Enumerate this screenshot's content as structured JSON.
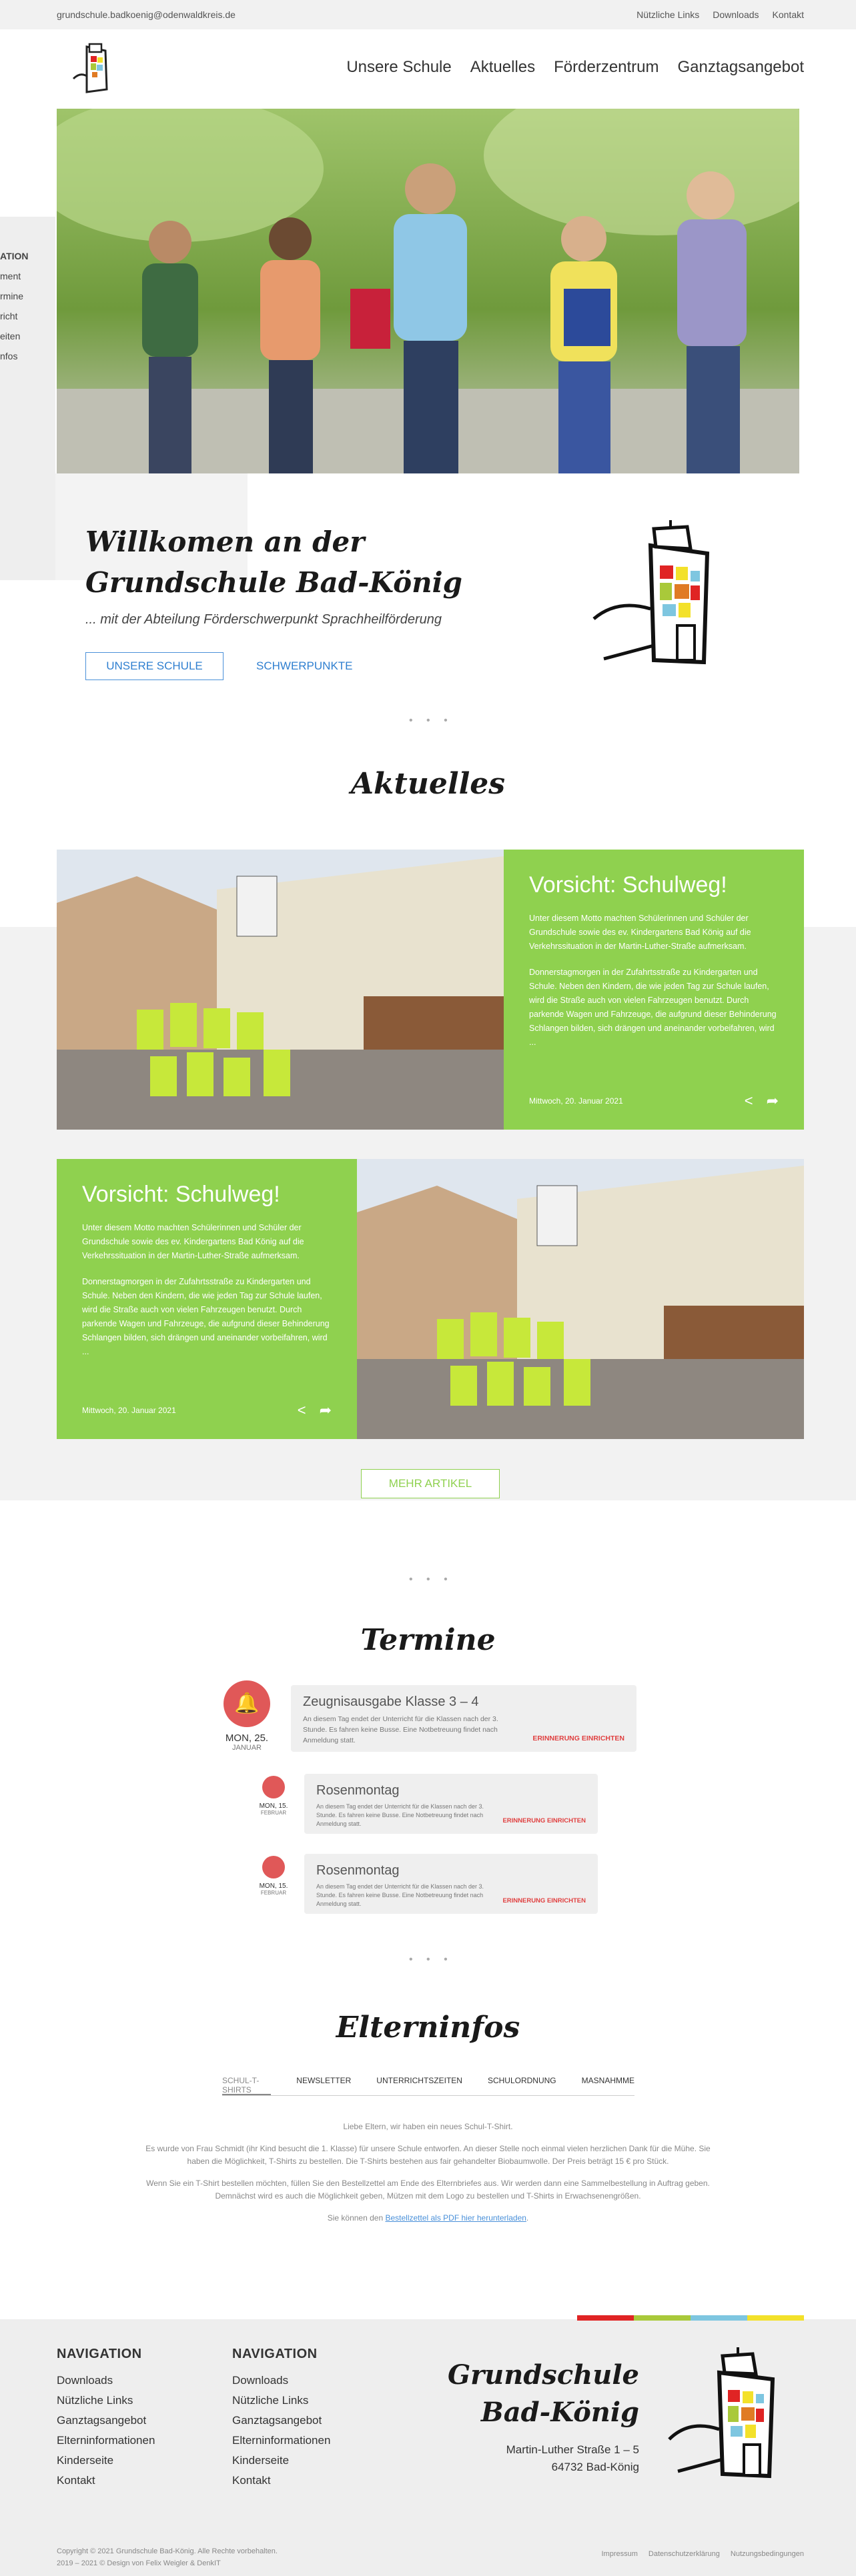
{
  "topbar": {
    "email": "grundschule.badkoenig@odenwaldkreis.de",
    "links": [
      "Nützliche Links",
      "Downloads",
      "Kontakt"
    ]
  },
  "nav": [
    "Unsere Schule",
    "Aktuelles",
    "Förderzentrum",
    "Ganztagsangebot"
  ],
  "side_menu": [
    "ATION",
    "ment",
    "rmine",
    "richt",
    "eiten",
    "nfos"
  ],
  "welcome": {
    "title_line1": "Willkomen an der",
    "title_line2": "Grundschule Bad-König",
    "subtitle": "... mit der Abteilung Förderschwerpunkt Sprachheilförderung",
    "btn_primary": "UNSERE SCHULE",
    "btn_secondary": "SCHWERPUNKTE"
  },
  "dots": "• • •",
  "aktuelles": {
    "title": "Aktuelles",
    "articles": [
      {
        "title": "Vorsicht: Schulweg!",
        "p1": "Unter diesem Motto machten Schülerinnen und Schüler der Grundschule sowie des ev. Kindergartens Bad König auf die Verkehrssituation in der Martin-Luther-Straße aufmerksam.",
        "p2": "Donnerstagmorgen in der Zufahrtsstraße zu Kindergarten und Schule. Neben den Kindern, die wie jeden Tag zur Schule laufen, wird die Straße auch von vielen Fahrzeugen benutzt. Durch parkende Wagen und Fahrzeuge, die aufgrund dieser Behinderung Schlangen bilden, sich drängen und aneinander vorbeifahren, wird ...",
        "date": "Mittwoch, 20. Januar 2021"
      },
      {
        "title": "Vorsicht: Schulweg!",
        "p1": "Unter diesem Motto machten Schülerinnen und Schüler der Grundschule sowie des ev. Kindergartens Bad König auf die Verkehrssituation in der Martin-Luther-Straße aufmerksam.",
        "p2": "Donnerstagmorgen in der Zufahrtsstraße zu Kindergarten und Schule. Neben den Kindern, die wie jeden Tag zur Schule laufen, wird die Straße auch von vielen Fahrzeugen benutzt. Durch parkende Wagen und Fahrzeuge, die aufgrund dieser Behinderung Schlangen bilden, sich drängen und aneinander vorbeifahren, wird ...",
        "date": "Mittwoch, 20. Januar 2021"
      }
    ],
    "more": "MEHR ARTIKEL"
  },
  "termine": {
    "title": "Termine",
    "events": [
      {
        "day": "MON, 25.",
        "month": "JANUAR",
        "title": "Zeugnisausgabe Klasse 3 – 4",
        "text": "An diesem Tag endet der Unterricht für die Klassen nach der 3. Stunde. Es fahren keine Busse. Eine Notbetreuung findet nach Anmeldung statt.",
        "remind": "ERINNERUNG EINRICHTEN"
      },
      {
        "day": "MON, 15.",
        "month": "FEBRUAR",
        "title": "Rosenmontag",
        "text": "An diesem Tag endet der Unterricht für die Klassen nach der 3. Stunde. Es fahren keine Busse. Eine Notbetreuung findet nach Anmeldung statt.",
        "remind": "ERINNERUNG EINRICHTEN"
      },
      {
        "day": "MON, 15.",
        "month": "FEBRUAR",
        "title": "Rosenmontag",
        "text": "An diesem Tag endet der Unterricht für die Klassen nach der 3. Stunde. Es fahren keine Busse. Eine Notbetreuung findet nach Anmeldung statt.",
        "remind": "ERINNERUNG EINRICHTEN"
      }
    ]
  },
  "elterninfos": {
    "title": "Elterninfos",
    "tabs": [
      "SCHUL-T-SHIRTS",
      "NEWSLETTER",
      "UNTERRICHTSZEITEN",
      "SCHULORDNUNG",
      "MASNAHMME"
    ],
    "p1": "Liebe Eltern, wir haben ein neues Schul-T-Shirt.",
    "p2": "Es wurde von Frau Schmidt (ihr Kind besucht die 1. Klasse) für unsere Schule entworfen. An dieser Stelle noch einmal vielen herzlichen Dank für die Mühe. Sie haben die Möglichkeit, T-Shirts zu bestellen. Die T-Shirts bestehen aus fair gehandelter Biobaumwolle. Der Preis beträgt 15 € pro Stück.",
    "p3": "Wenn Sie ein T-Shirt bestellen möchten, füllen Sie den Bestellzettel am Ende des Elternbriefes aus. Wir werden dann eine Sammelbestellung in Auftrag geben. Demnächst wird es auch die Möglichkeit geben, Mützen mit dem Logo zu bestellen und T-Shirts in Erwachsenengrößen.",
    "p4_prefix": "Sie können den ",
    "p4_link": "Bestellzettel als PDF hier herunterladen",
    "p4_suffix": "."
  },
  "footer": {
    "col1_title": "NAVIGATION",
    "col1": [
      "Downloads",
      "Nützliche Links",
      "Ganztagsangebot",
      "Elterninformationen",
      "Kinderseite",
      "Kontakt"
    ],
    "col2_title": "NAVIGATION",
    "col2": [
      "Downloads",
      "Nützliche Links",
      "Ganztagsangebot",
      "Elterninformationen",
      "Kinderseite",
      "Kontakt"
    ],
    "school_line1": "Grundschule",
    "school_line2": "Bad-König",
    "street": "Martin-Luther Straße 1 – 5",
    "city": "64732 Bad-König",
    "copy1": "Copyright © 2021 Grundschule Bad-König. Alle Rechte vorbehalten.",
    "copy2": "2019 – 2021 © Design von Felix Weigler & DenkIT",
    "legal": [
      "Impressum",
      "Datenschutzerklärung",
      "Nutzungsbedingungen"
    ],
    "bar_colors": [
      "#e02424",
      "#a9c93a",
      "#7ec6e0",
      "#f3e12a"
    ]
  },
  "colors": {
    "accent_green": "#8fd14f",
    "accent_blue": "#2f7fd0",
    "accent_red": "#e05858"
  }
}
